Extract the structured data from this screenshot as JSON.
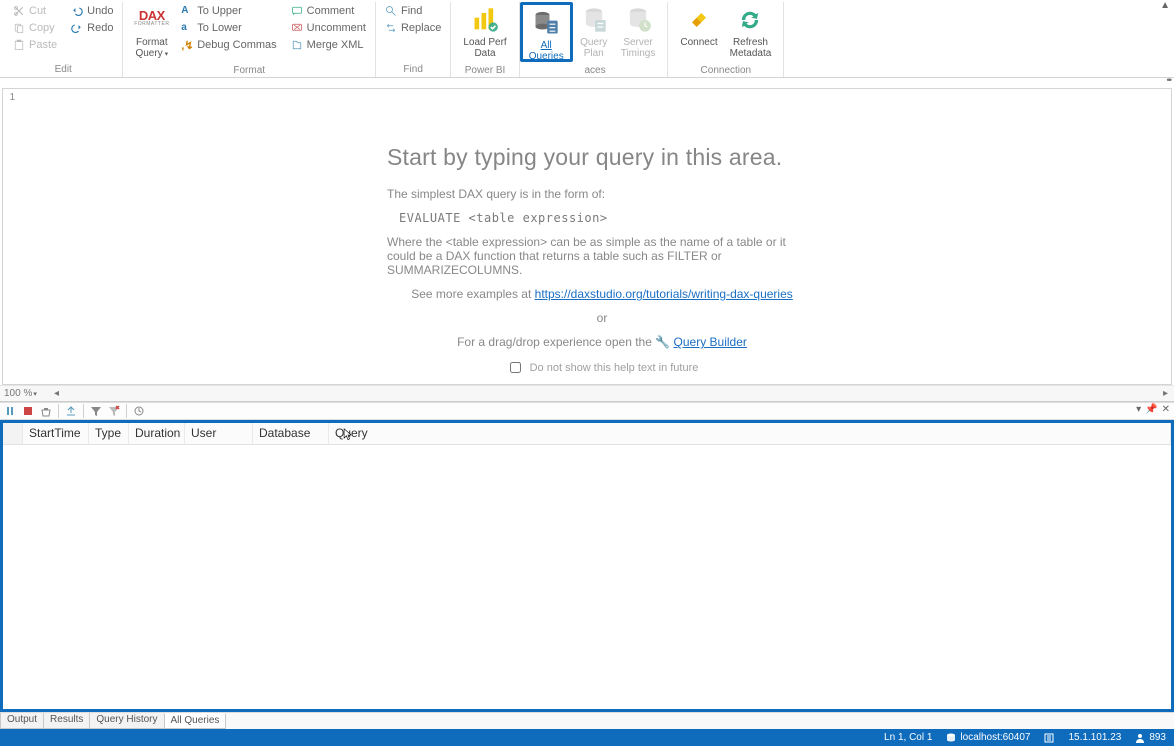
{
  "ribbon": {
    "edit": {
      "cut": "Cut",
      "copy": "Copy",
      "paste": "Paste",
      "undo": "Undo",
      "redo": "Redo",
      "group": "Edit"
    },
    "format": {
      "format_query": "Format\nQuery",
      "dax_logo": "DAX",
      "to_upper": "To Upper",
      "to_lower": "To Lower",
      "debug_commas": "Debug Commas",
      "comment": "Comment",
      "uncomment": "Uncomment",
      "merge_xml": "Merge XML",
      "group": "Format"
    },
    "find": {
      "find": "Find",
      "replace": "Replace",
      "group": "Find"
    },
    "powerbi": {
      "load_perf": "Load Perf\nData",
      "group": "Power BI"
    },
    "traces": {
      "all_queries": "All\nQueries",
      "query_plan": "Query\nPlan",
      "server_timings": "Server\nTimings",
      "group": "Traces"
    },
    "connection": {
      "connect": "Connect",
      "refresh_metadata": "Refresh\nMetadata",
      "group": "Connection"
    }
  },
  "editor": {
    "line_no": "1",
    "title": "Start by typing your query in this area.",
    "intro": "The simplest DAX query is in the form of:",
    "code": "EVALUATE <table expression>",
    "body": "Where the <table expression> can be as simple as the name of a table or it could be a DAX function that returns a table such as FILTER or SUMMARIZECOLUMNS.",
    "examples_prefix": "See more examples at ",
    "examples_link": "https://daxstudio.org/tutorials/writing-dax-queries",
    "or": "or",
    "drag_prefix": "For a drag/drop experience open the ",
    "query_builder": "Query Builder",
    "checkbox_label": "Do not show this help text in future",
    "zoom": "100 %"
  },
  "grid": {
    "columns": {
      "start": "StartTime",
      "type": "Type",
      "duration": "Duration",
      "user": "User",
      "database": "Database",
      "query": "Query"
    }
  },
  "tabs": {
    "output": "Output",
    "results": "Results",
    "history": "Query History",
    "allq": "All Queries"
  },
  "status": {
    "lncol": "Ln 1, Col 1",
    "server": "localhost:60407",
    "version": "15.1.101.23",
    "count": "893"
  }
}
